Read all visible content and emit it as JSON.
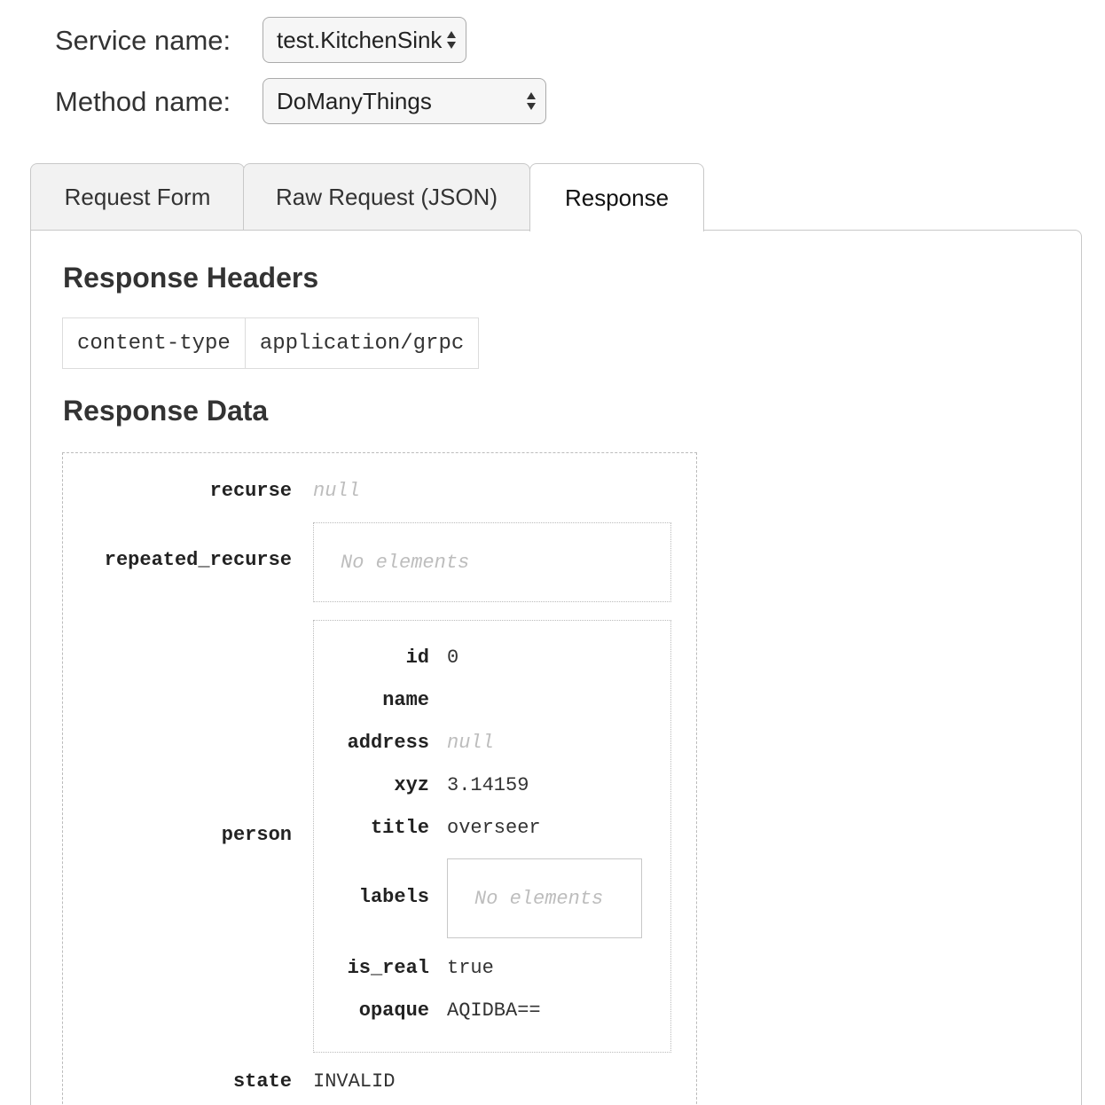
{
  "selectors": {
    "service_label": "Service name:",
    "service_value": "test.KitchenSink",
    "method_label": "Method name:",
    "method_value": "DoManyThings"
  },
  "tabs": [
    {
      "label": "Request Form",
      "active": false
    },
    {
      "label": "Raw Request (JSON)",
      "active": false
    },
    {
      "label": "Response",
      "active": true
    }
  ],
  "response": {
    "headers_title": "Response Headers",
    "headers": [
      {
        "name": "content-type",
        "value": "application/grpc"
      }
    ],
    "data_title": "Response Data",
    "fields": {
      "recurse": {
        "key": "recurse",
        "value": "null"
      },
      "repeated_recurse": {
        "key": "repeated_recurse",
        "value": "No elements"
      },
      "person": {
        "key": "person",
        "fields": {
          "id": {
            "key": "id",
            "value": "0"
          },
          "name": {
            "key": "name",
            "value": ""
          },
          "address": {
            "key": "address",
            "value": "null"
          },
          "xyz": {
            "key": "xyz",
            "value": "3.14159"
          },
          "title": {
            "key": "title",
            "value": "overseer"
          },
          "labels": {
            "key": "labels",
            "value": "No elements"
          },
          "is_real": {
            "key": "is_real",
            "value": "true"
          },
          "opaque": {
            "key": "opaque",
            "value": "AQIDBA=="
          }
        }
      },
      "state": {
        "key": "state",
        "value": "INVALID"
      }
    }
  },
  "colors": {
    "tab_inactive_bg": "#f2f2f2",
    "border": "#c8c8c8",
    "null_text": "#bdbdbd"
  }
}
